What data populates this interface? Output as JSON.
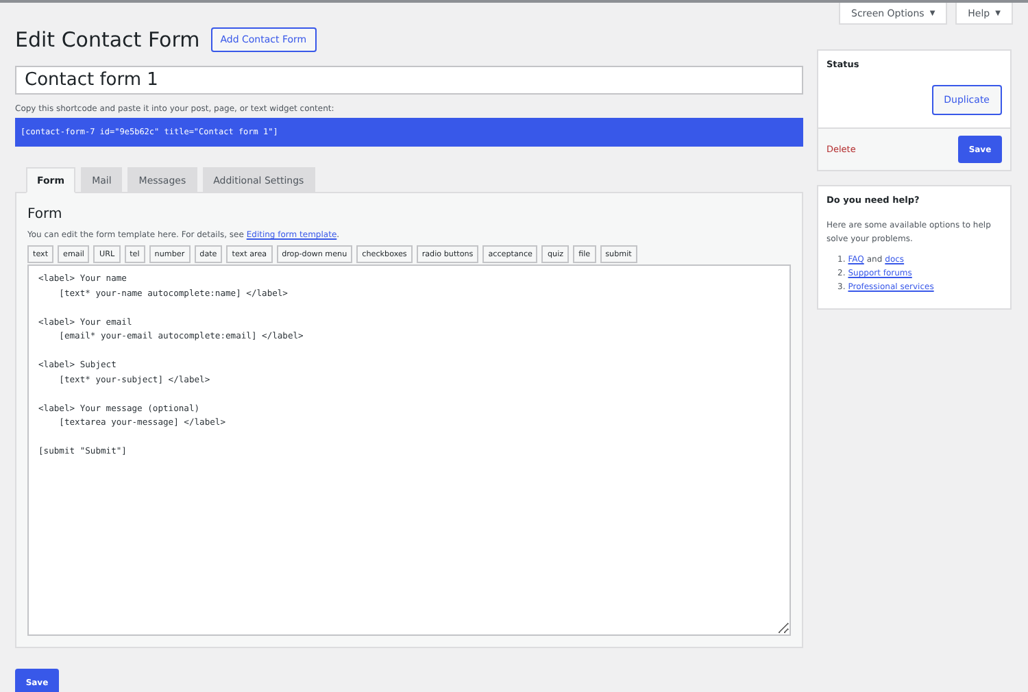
{
  "top_tabs": [
    {
      "label": "Screen Options",
      "caret": "▼"
    },
    {
      "label": "Help",
      "caret": "▼"
    }
  ],
  "heading": {
    "title": "Edit Contact Form",
    "action": "Add Contact Form"
  },
  "title_field": {
    "value": "Contact form 1"
  },
  "shortcode": {
    "hint": "Copy this shortcode and paste it into your post, page, or text widget content:",
    "code": "[contact-form-7 id=\"9e5b62c\" title=\"Contact form 1\"]"
  },
  "tabs": [
    {
      "label": "Form",
      "selected": true
    },
    {
      "label": "Mail",
      "selected": false
    },
    {
      "label": "Messages",
      "selected": false
    },
    {
      "label": "Additional Settings",
      "selected": false
    }
  ],
  "panel": {
    "title": "Form",
    "description": "You can edit the form template here. For details, see ",
    "link": "Editing form template",
    "link_tail": ".",
    "tag_buttons": [
      "text",
      "email",
      "URL",
      "tel",
      "number",
      "date",
      "text area",
      "drop-down menu",
      "checkboxes",
      "radio buttons",
      "acceptance",
      "quiz",
      "file",
      "submit"
    ],
    "template": "<label> Your name\n    [text* your-name autocomplete:name] </label>\n\n<label> Your email\n    [email* your-email autocomplete:email] </label>\n\n<label> Subject\n    [text* your-subject] </label>\n\n<label> Your message (optional)\n    [textarea your-message] </label>\n\n[submit \"Submit\"]"
  },
  "save_button": "Save",
  "status_box": {
    "title": "Status",
    "duplicate": "Duplicate",
    "delete": "Delete",
    "save": "Save"
  },
  "help_box": {
    "title": "Do you need help?",
    "text": "Here are some available options to help solve your problems.",
    "items": [
      {
        "number": "1.",
        "parts": [
          {
            "kind": "link",
            "text": "FAQ"
          },
          {
            "kind": "text",
            "text": "and"
          },
          {
            "kind": "link",
            "text": "docs"
          }
        ]
      },
      {
        "number": "2.",
        "parts": [
          {
            "kind": "link",
            "text": "Support forums"
          }
        ]
      },
      {
        "number": "3.",
        "parts": [
          {
            "kind": "link",
            "text": "Professional services"
          }
        ]
      }
    ]
  }
}
